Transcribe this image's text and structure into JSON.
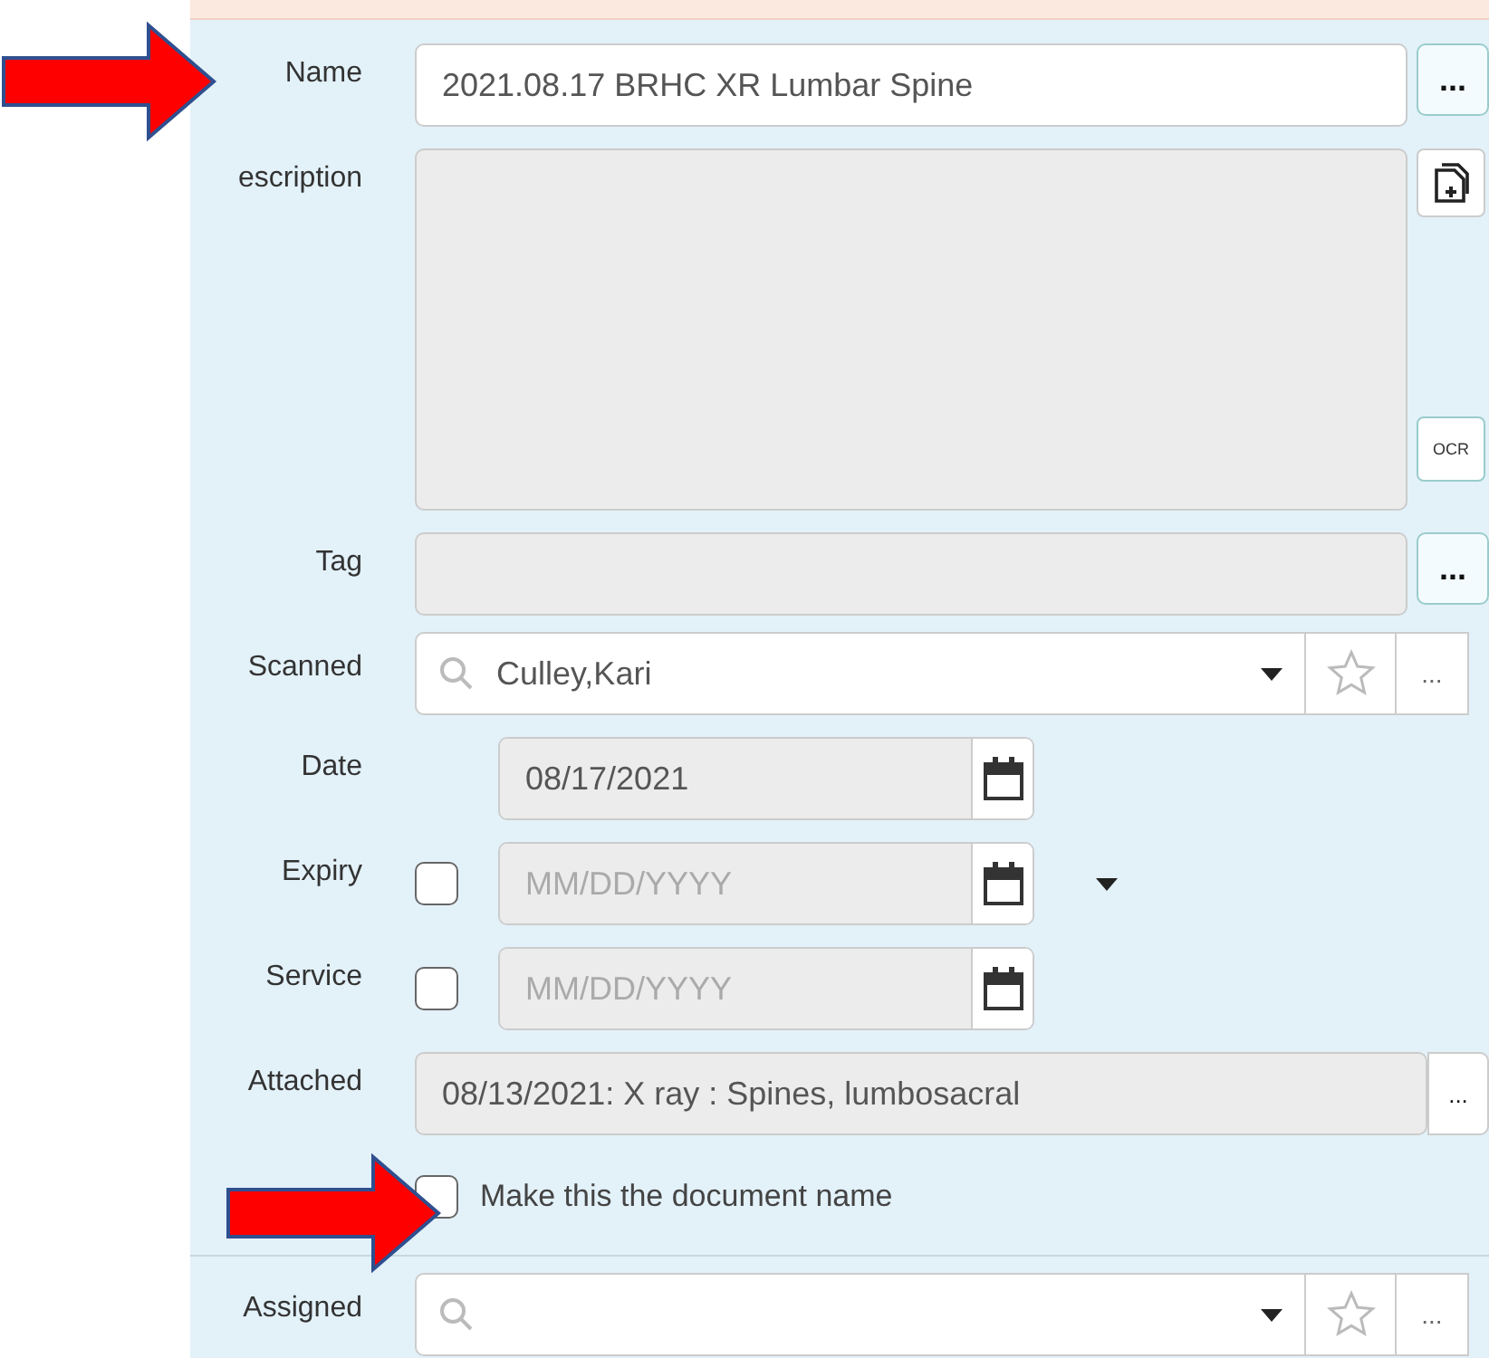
{
  "fields": [
    {
      "kind": "text",
      "label": "Name",
      "value": "2021.08.17 BRHC XR Lumbar Spine",
      "disabled": false,
      "button_text": "...",
      "arrow": true
    },
    {
      "kind": "textarea",
      "label": "escription",
      "disabled": true,
      "side_button": "OCR"
    },
    {
      "kind": "text",
      "label": "Tag",
      "disabled": true,
      "button_text": "..."
    },
    {
      "kind": "combobox",
      "label": "Scanned",
      "value": "Culley,Kari",
      "button_text": "..."
    },
    {
      "kind": "date",
      "label": "Date",
      "value": "08/17/2021"
    },
    {
      "kind": "date",
      "label": "Expiry",
      "checked": false,
      "placeholder": "MM/DD/YYYY",
      "dropdown": true
    },
    {
      "kind": "date",
      "label": "Service",
      "checked": false,
      "placeholder": "MM/DD/YYYY"
    },
    {
      "kind": "text",
      "label": "Attached",
      "value": "08/13/2021: X ray : Spines, lumbosacral",
      "disabled": true,
      "button_text": "..."
    },
    {
      "kind": "checkbox",
      "label": "Make this the document name",
      "checked": false,
      "arrow": true
    },
    {
      "kind": "combobox",
      "label": "Assigned",
      "button_text": "..."
    }
  ]
}
